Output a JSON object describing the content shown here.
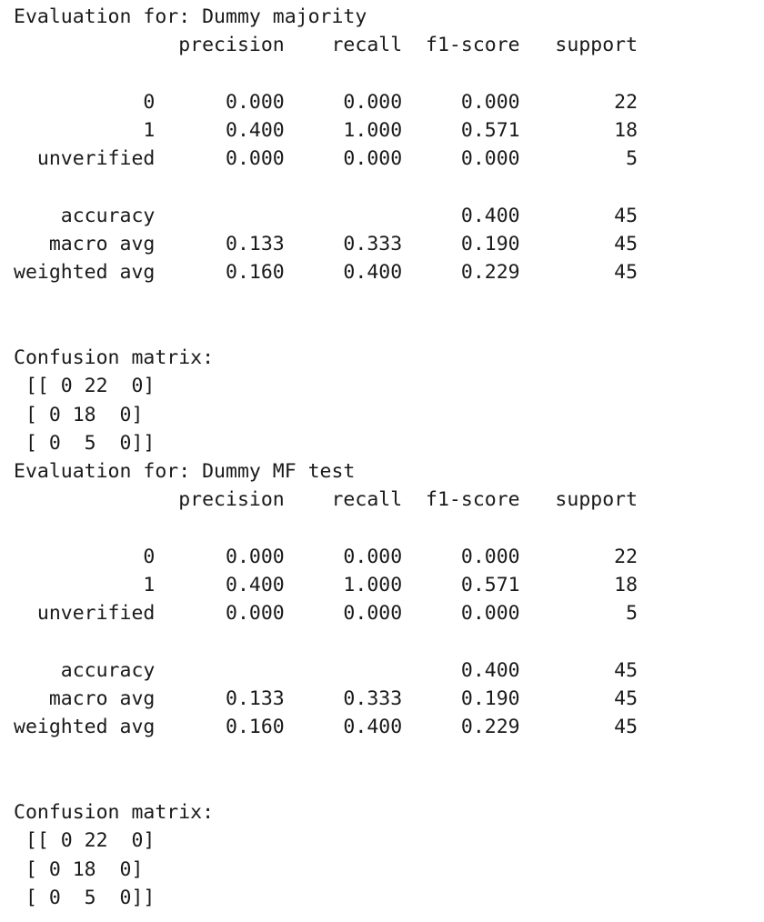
{
  "output_lines": [
    "Evaluation for: Dummy majority",
    "              precision    recall  f1-score   support",
    "",
    "           0      0.000     0.000     0.000        22",
    "           1      0.400     1.000     0.571        18",
    "  unverified      0.000     0.000     0.000         5",
    "",
    "    accuracy                          0.400        45",
    "   macro avg      0.133     0.333     0.190        45",
    "weighted avg      0.160     0.400     0.229        45",
    "",
    "",
    "Confusion matrix:",
    " [[ 0 22  0]",
    " [ 0 18  0]",
    " [ 0  5  0]]",
    "Evaluation for: Dummy MF test",
    "              precision    recall  f1-score   support",
    "",
    "           0      0.000     0.000     0.000        22",
    "           1      0.400     1.000     0.571        18",
    "  unverified      0.000     0.000     0.000         5",
    "",
    "    accuracy                          0.400        45",
    "   macro avg      0.133     0.333     0.190        45",
    "weighted avg      0.160     0.400     0.229        45",
    "",
    "",
    "Confusion matrix:",
    " [[ 0 22  0]",
    " [ 0 18  0]",
    " [ 0  5  0]]"
  ]
}
